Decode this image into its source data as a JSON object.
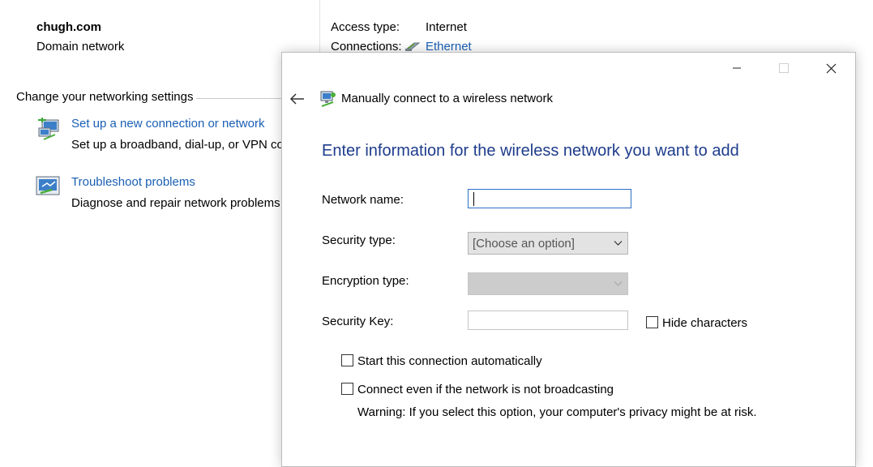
{
  "background": {
    "network_name": "chugh.com",
    "network_type": "Domain network",
    "access_type_label": "Access type:",
    "access_type_value": "Internet",
    "connections_label": "Connections:",
    "connection_name": "Ethernet",
    "section_title": "Change your networking settings",
    "tasks": [
      {
        "icon": "new-connection-icon",
        "link": "Set up a new connection or network",
        "description": "Set up a broadband, dial-up, or VPN co"
      },
      {
        "icon": "troubleshoot-icon",
        "link": "Troubleshoot problems",
        "description": "Diagnose and repair network problems"
      }
    ]
  },
  "dialog": {
    "title": "Manually connect to a wireless network",
    "heading": "Enter information for the wireless network you want to add",
    "fields": {
      "network_name_label": "Network name:",
      "network_name_value": "",
      "security_type_label": "Security type:",
      "security_type_value": "[Choose an option]",
      "encryption_type_label": "Encryption type:",
      "encryption_type_value": "",
      "security_key_label": "Security Key:",
      "security_key_value": ""
    },
    "checkboxes": {
      "hide_characters": {
        "label": "Hide characters",
        "checked": false
      },
      "start_automatically": {
        "label": "Start this connection automatically",
        "checked": false
      },
      "connect_not_broadcasting": {
        "label": "Connect even if the network is not broadcasting",
        "checked": false
      }
    },
    "warning": "Warning: If you select this option, your computer's privacy might be at risk."
  },
  "colors": {
    "link": "#1a5fb4",
    "heading": "#1e3c8c",
    "focus_border": "#2b6fc7",
    "disabled_field": "#cccccc"
  }
}
